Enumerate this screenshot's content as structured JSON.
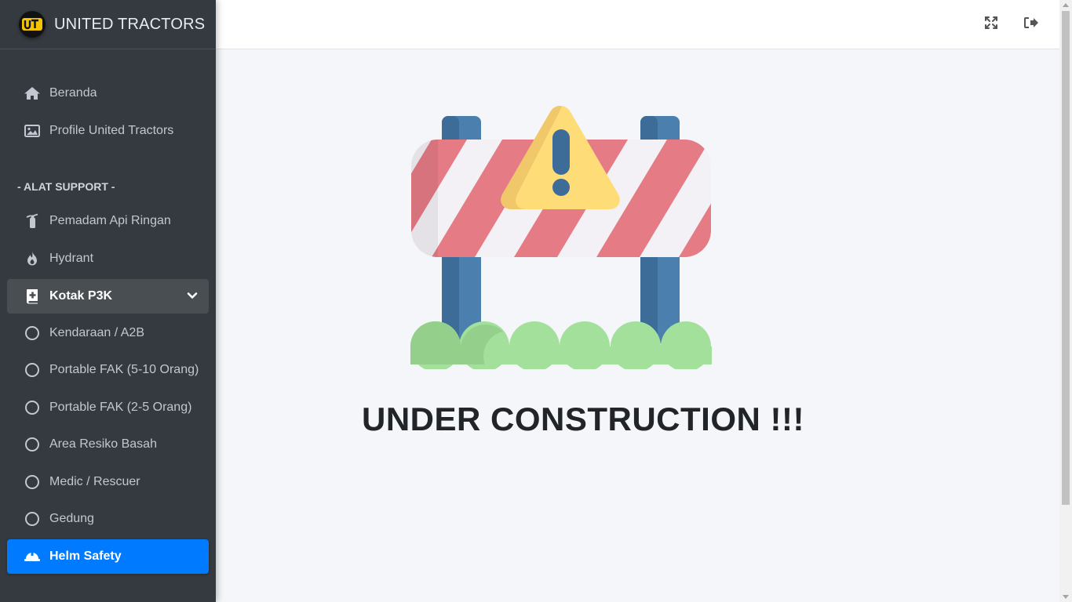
{
  "brand": {
    "name": "UNITED TRACTORS",
    "logo_text": "ut",
    "logo_color": "#f5c400"
  },
  "sidebar": {
    "items": [
      {
        "label": "Beranda",
        "icon": "home-icon"
      },
      {
        "label": "Profile United Tractors",
        "icon": "image-icon"
      }
    ],
    "section_header": "- ALAT SUPPORT -",
    "support_items": [
      {
        "label": "Pemadam Api Ringan",
        "icon": "fire-extinguisher-icon"
      },
      {
        "label": "Hydrant",
        "icon": "fire-icon"
      },
      {
        "label": "Kotak P3K",
        "icon": "medical-book-icon",
        "state": "open"
      },
      {
        "label": "Kendaraan / A2B",
        "icon": "circle-icon"
      },
      {
        "label": "Portable FAK (5-10 Orang)",
        "icon": "circle-icon"
      },
      {
        "label": "Portable FAK (2-5 Orang)",
        "icon": "circle-icon"
      },
      {
        "label": "Area Resiko Basah",
        "icon": "circle-icon"
      },
      {
        "label": "Medic / Rescuer",
        "icon": "circle-icon"
      },
      {
        "label": "Gedung",
        "icon": "circle-icon"
      },
      {
        "label": "Helm Safety",
        "icon": "hard-hat-icon",
        "state": "active"
      }
    ]
  },
  "topbar": {
    "fullscreen_icon": "expand-icon",
    "logout_icon": "sign-out-icon"
  },
  "main": {
    "message": "UNDER CONSTRUCTION !!!"
  },
  "colors": {
    "sidebar_bg": "#343a40",
    "active": "#007bff",
    "content_bg": "#f4f6f9"
  }
}
